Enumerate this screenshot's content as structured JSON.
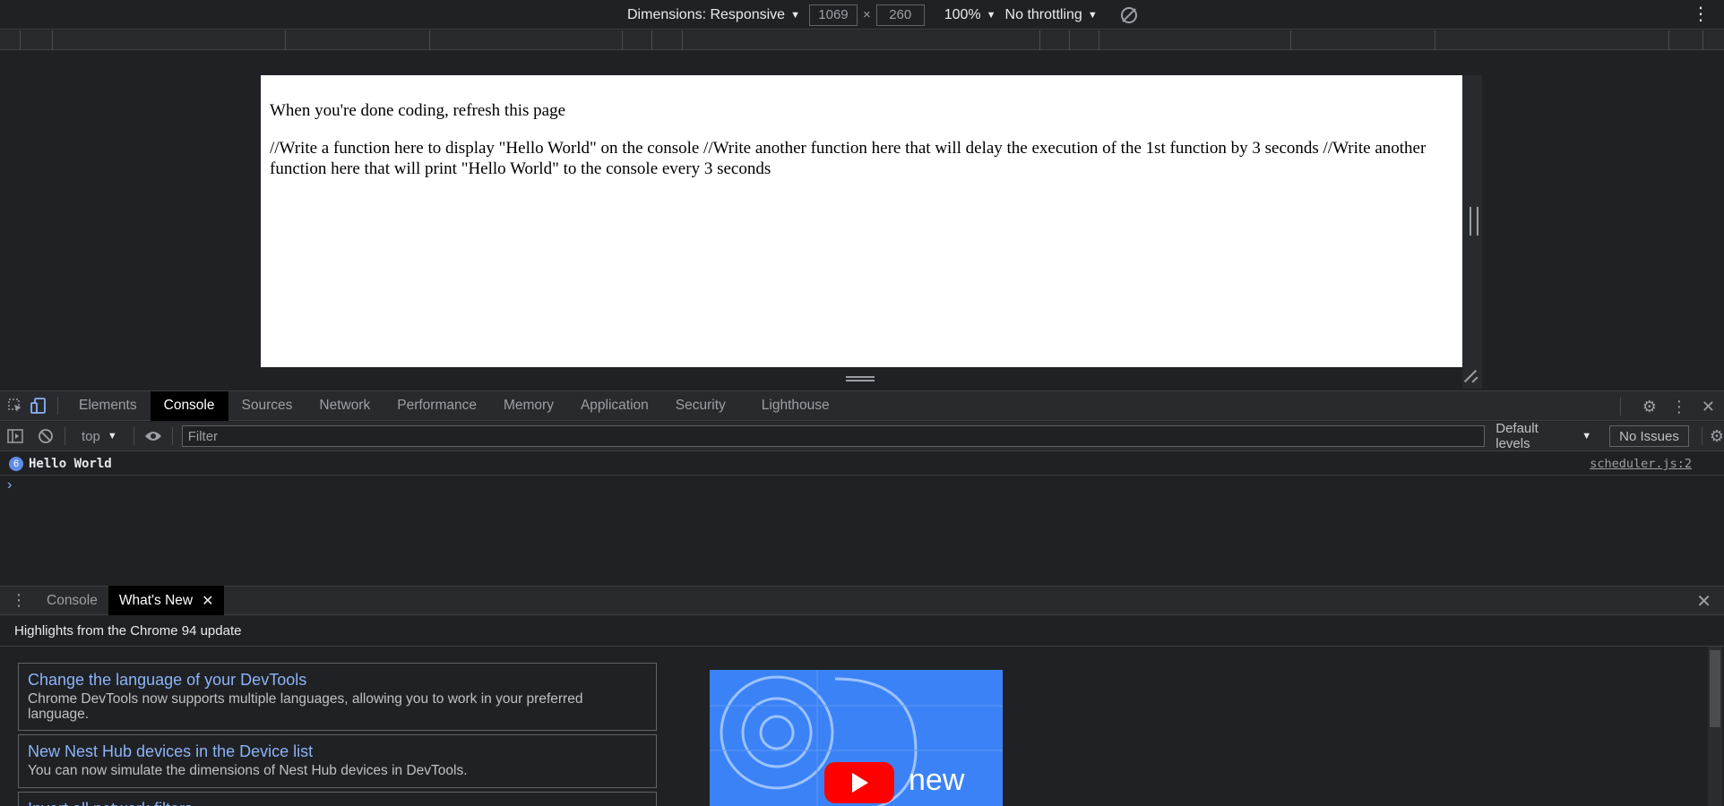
{
  "device_toolbar": {
    "dimensions_label": "Dimensions: Responsive",
    "width_value": "1069",
    "height_value": "260",
    "times_symbol": "×",
    "zoom": "100%",
    "throttling": "No throttling"
  },
  "page": {
    "line1": "When you're done coding, refresh this page",
    "line2": "//Write a function here to display \"Hello World\" on the console //Write another function here that will delay the execution of the 1st function by 3 seconds //Write another function here that will print \"Hello World\" to the console every 3 seconds"
  },
  "devtools": {
    "tabs": [
      "Elements",
      "Console",
      "Sources",
      "Network",
      "Performance",
      "Memory",
      "Application",
      "Security",
      "Lighthouse"
    ],
    "active_tab": "Console"
  },
  "console_toolbar": {
    "context": "top",
    "filter_placeholder": "Filter",
    "levels": "Default levels",
    "issues": "No Issues"
  },
  "console": {
    "messages": [
      {
        "count": "6",
        "text": "Hello World",
        "source": "scheduler.js:2"
      }
    ],
    "prompt": "›"
  },
  "drawer": {
    "tabs": [
      "Console",
      "What's New"
    ],
    "active_tab": "What's New",
    "heading": "Highlights from the Chrome 94 update",
    "cards": [
      {
        "title": "Change the language of your DevTools",
        "desc": "Chrome DevTools now supports multiple languages, allowing you to work in your preferred language."
      },
      {
        "title": "New Nest Hub devices in the Device list",
        "desc": "You can now simulate the dimensions of Nest Hub devices in DevTools."
      },
      {
        "title": "Invert all network filters",
        "desc": ""
      }
    ],
    "video_text": "new"
  },
  "colors": {
    "bg": "#202124",
    "toolbar": "#292a2d",
    "accent_link": "#8ab4f8",
    "info_badge": "#5e8de6",
    "video_bg": "#3b82f6"
  }
}
